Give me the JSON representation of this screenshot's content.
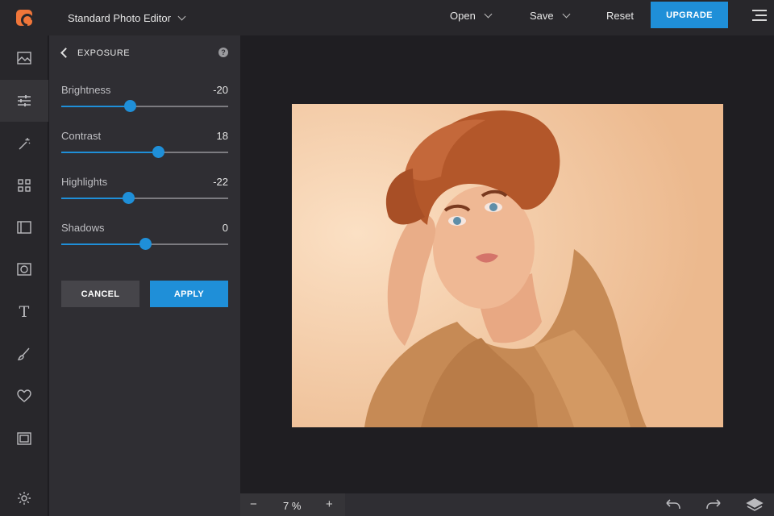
{
  "app": {
    "title": "Standard Photo Editor",
    "accent_color": "#1f8fd8",
    "logo_color": "#f0763a"
  },
  "topbar": {
    "open_label": "Open",
    "save_label": "Save",
    "reset_label": "Reset",
    "upgrade_label": "UPGRADE",
    "menu_icon": "hamburger-icon"
  },
  "rail": {
    "items": [
      {
        "name": "image",
        "icon": "image-icon",
        "active": false
      },
      {
        "name": "adjust",
        "icon": "sliders-icon",
        "active": true
      },
      {
        "name": "effects",
        "icon": "magic-wand-icon",
        "active": false
      },
      {
        "name": "grid",
        "icon": "grid-icon",
        "active": false
      },
      {
        "name": "frames",
        "icon": "film-frame-icon",
        "active": false
      },
      {
        "name": "overlay",
        "icon": "circle-square-icon",
        "active": false
      },
      {
        "name": "text",
        "icon": "text-icon",
        "glyph": "T",
        "active": false
      },
      {
        "name": "draw",
        "icon": "brush-icon",
        "active": false
      },
      {
        "name": "stickers",
        "icon": "heart-icon",
        "active": false
      },
      {
        "name": "border",
        "icon": "border-icon",
        "active": false
      },
      {
        "name": "settings",
        "icon": "gear-icon",
        "active": false
      }
    ]
  },
  "panel": {
    "title": "EXPOSURE",
    "help_glyph": "?",
    "sliders": [
      {
        "label": "Brightness",
        "value": "-20",
        "position": 0.41
      },
      {
        "label": "Contrast",
        "value": "18",
        "position": 0.58
      },
      {
        "label": "Highlights",
        "value": "-22",
        "position": 0.4
      },
      {
        "label": "Shadows",
        "value": "0",
        "position": 0.5
      }
    ],
    "cancel_label": "CANCEL",
    "apply_label": "APPLY"
  },
  "bottombar": {
    "zoom_minus": "−",
    "zoom_value": "7 %",
    "zoom_plus": "+",
    "undo_icon": "undo-icon",
    "redo_icon": "redo-icon",
    "layers_icon": "layers-icon"
  }
}
